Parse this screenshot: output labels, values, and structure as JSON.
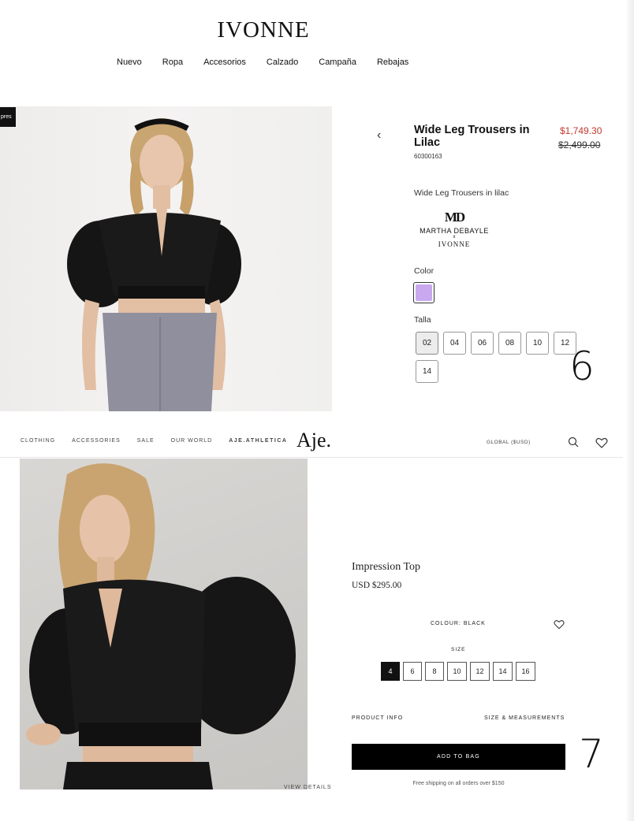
{
  "ivonne": {
    "logo": "IVONNE",
    "nav": [
      "Nuevo",
      "Ropa",
      "Accesorios",
      "Calzado",
      "Campaña",
      "Rebajas"
    ],
    "badge": "pres",
    "product": {
      "title": "Wide Leg Trousers in Lilac",
      "sku": "60300163",
      "price_sale": "$1,749.30",
      "price_original": "$2,499.00",
      "description": "Wide Leg Trousers in lilac",
      "collab": {
        "monogram": "MD",
        "line1": "MARTHA DEBAYLE",
        "x": "x",
        "line2": "IVONNE"
      },
      "color_label": "Color",
      "color_swatch": "#c9a8ef",
      "size_label": "Talla",
      "sizes": [
        "02",
        "04",
        "06",
        "08",
        "10",
        "12",
        "14"
      ],
      "selected_size": "02"
    },
    "annotation": "6"
  },
  "aje": {
    "nav": [
      "CLOTHING",
      "ACCESSORIES",
      "SALE",
      "OUR WORLD",
      "AJE.ATHLETICA"
    ],
    "logo": "Aje.",
    "region": "GLOBAL ($USD)",
    "product": {
      "title": "Impression Top",
      "price": "USD $295.00",
      "colour_label": "COLOUR: BLACK",
      "size_label": "SIZE",
      "sizes": [
        "4",
        "6",
        "8",
        "10",
        "12",
        "14",
        "16"
      ],
      "selected_size": "4",
      "product_info": "PRODUCT INFO",
      "size_measurements": "SIZE & MEASUREMENTS",
      "add_to_bag": "ADD TO BAG",
      "shipping": "Free shipping on all orders over $150",
      "view_details": "VIEW DETAILS"
    },
    "annotation": "7"
  },
  "colors": {
    "sale_red": "#c0392b",
    "lilac": "#c9a8ef",
    "black": "#000000"
  }
}
